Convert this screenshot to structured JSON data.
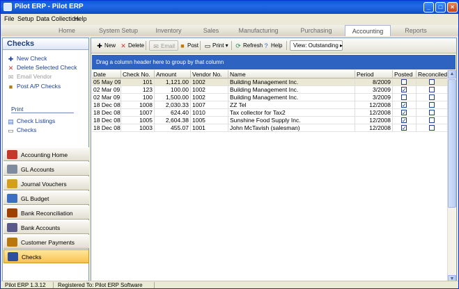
{
  "window": {
    "title": "Pilot ERP - Pilot ERP",
    "controls": {
      "minimize": "_",
      "maximize": "□",
      "close": "×"
    }
  },
  "menubar": {
    "items": [
      "File",
      "Setup",
      "Data Collection",
      "Help"
    ]
  },
  "tabs": {
    "items": [
      "Home",
      "System Setup",
      "Inventory",
      "Sales",
      "Manufacturing",
      "Purchasing",
      "Accounting",
      "Reports"
    ],
    "active": "Accounting"
  },
  "sidebar": {
    "title": "Checks",
    "actions": [
      {
        "label": "New Check",
        "icon": "new-check-icon",
        "enabled": true
      },
      {
        "label": "Delete Selected Check",
        "icon": "delete-icon",
        "enabled": true
      },
      {
        "label": "Email Vendor",
        "icon": "email-icon",
        "enabled": false
      },
      {
        "label": "Post A/P Checks",
        "icon": "post-icon",
        "enabled": true
      }
    ],
    "print_heading": "Print",
    "print_items": [
      {
        "label": "Check Listings",
        "icon": "document-icon"
      },
      {
        "label": "Checks",
        "icon": "printer-icon"
      }
    ],
    "nav": [
      {
        "label": "Accounting Home",
        "icon": "accounting-home-icon",
        "color": "#c0392b"
      },
      {
        "label": "GL Accounts",
        "icon": "gl-accounts-icon",
        "color": "#7f8c9d"
      },
      {
        "label": "Journal Vouchers",
        "icon": "journal-vouchers-icon",
        "color": "#d4a017"
      },
      {
        "label": "GL Budget",
        "icon": "gl-budget-icon",
        "color": "#3c6fc4"
      },
      {
        "label": "Bank Reconciliation",
        "icon": "bank-reconciliation-icon",
        "color": "#a04000"
      },
      {
        "label": "Bank Accounts",
        "icon": "bank-accounts-icon",
        "color": "#5a5a8a"
      },
      {
        "label": "Customer Payments",
        "icon": "customer-payments-icon",
        "color": "#b9770e"
      },
      {
        "label": "Checks",
        "icon": "checks-icon",
        "color": "#2e4e9e"
      }
    ],
    "active_nav": "Checks"
  },
  "toolbar": {
    "new": "New",
    "delete": "Delete",
    "email": "Email",
    "post": "Post",
    "print": "Print",
    "refresh": "Refresh",
    "help": "Help",
    "view": "View: Outstanding"
  },
  "grid": {
    "group_hint": "Drag a column header here to group by that column",
    "columns": [
      "Date",
      "Check No.",
      "Amount",
      "Vendor No.",
      "Name",
      "Period",
      "Posted",
      "Reconciled"
    ],
    "rows": [
      {
        "date": "05 May 09",
        "check_no": "101",
        "amount": "1,121.00",
        "vendor_no": "1002",
        "name": "Building Management Inc.",
        "period": "8/2009",
        "posted": false,
        "reconciled": false
      },
      {
        "date": "02 Mar 09",
        "check_no": "123",
        "amount": "100.00",
        "vendor_no": "1002",
        "name": "Building Management Inc.",
        "period": "3/2009",
        "posted": true,
        "reconciled": false
      },
      {
        "date": "02 Mar 09",
        "check_no": "100",
        "amount": "1,500.00",
        "vendor_no": "1002",
        "name": "Building Management Inc.",
        "period": "3/2009",
        "posted": false,
        "reconciled": false
      },
      {
        "date": "18 Dec 08",
        "check_no": "1008",
        "amount": "2,030.33",
        "vendor_no": "1007",
        "name": "ZZ Tel",
        "period": "12/2008",
        "posted": true,
        "reconciled": false
      },
      {
        "date": "18 Dec 08",
        "check_no": "1007",
        "amount": "624.40",
        "vendor_no": "1010",
        "name": "Tax collector for Tax2",
        "period": "12/2008",
        "posted": true,
        "reconciled": false
      },
      {
        "date": "18 Dec 08",
        "check_no": "1005",
        "amount": "2,604.38",
        "vendor_no": "1005",
        "name": "Sunshine Food Supply Inc.",
        "period": "12/2008",
        "posted": true,
        "reconciled": false
      },
      {
        "date": "18 Dec 08",
        "check_no": "1003",
        "amount": "455.07",
        "vendor_no": "1001",
        "name": "John McTavish (salesman)",
        "period": "12/2008",
        "posted": true,
        "reconciled": false
      }
    ],
    "selected_row": 0
  },
  "statusbar": {
    "version": "Pilot ERP 1.3.12",
    "registered": "Registered To: Pilot ERP Software"
  },
  "colors": {
    "accent": "#2e63c2",
    "titlebar": "#0a5ad8",
    "active_nav": "#f9c250"
  }
}
